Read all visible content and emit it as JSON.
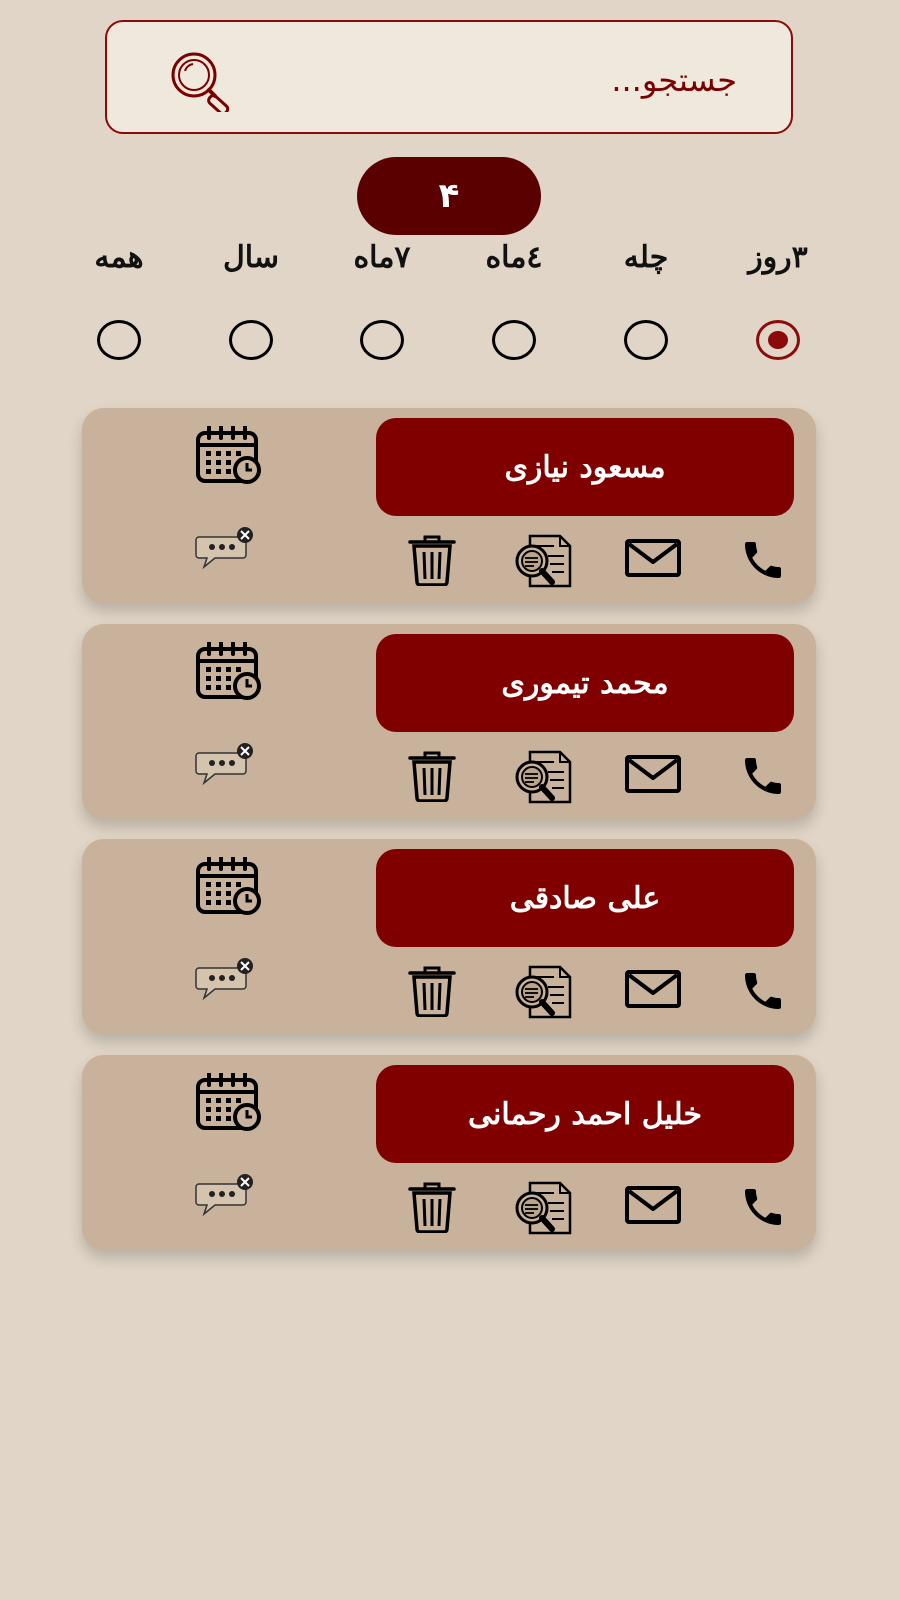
{
  "search": {
    "placeholder": "جستجو..."
  },
  "count_badge": "۴",
  "filters": [
    {
      "label": "۳روز",
      "selected": true
    },
    {
      "label": "چله",
      "selected": false
    },
    {
      "label": "٤ماه",
      "selected": false
    },
    {
      "label": "۷ماه",
      "selected": false
    },
    {
      "label": "سال",
      "selected": false
    },
    {
      "label": "همه",
      "selected": false
    }
  ],
  "contacts": [
    {
      "name": "مسعود نیازی"
    },
    {
      "name": "محمد تیموری"
    },
    {
      "name": "علی صادقی"
    },
    {
      "name": "خلیل احمد رحمانی"
    }
  ],
  "colors": {
    "background": "#e0d5c6",
    "card": "#c8b29b",
    "name_box": "#800000",
    "count_badge": "#5a0000",
    "accent": "#8b0a0a"
  },
  "icons": [
    "search-icon",
    "calendar-icon",
    "message-icon",
    "trash-icon",
    "document-search-icon",
    "mail-icon",
    "phone-icon"
  ]
}
